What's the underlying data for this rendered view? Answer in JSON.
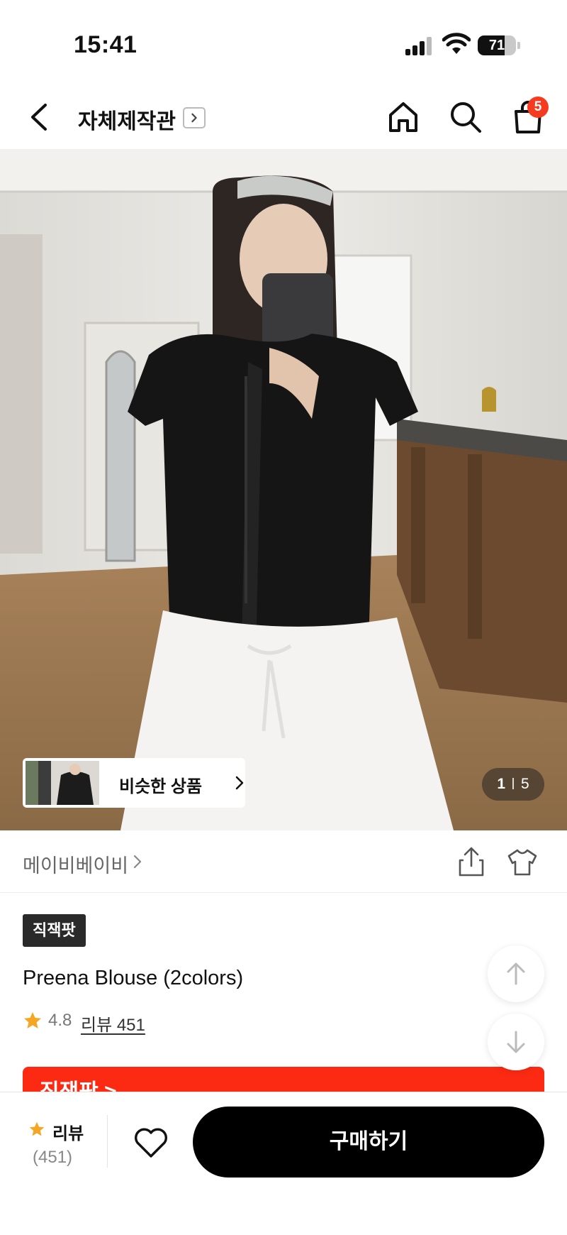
{
  "status_bar": {
    "time": "15:41",
    "battery": "71",
    "battery_level": 0.71
  },
  "header": {
    "title": "자체제작관",
    "back_icon": "chevron-left-icon",
    "home_icon": "home-icon",
    "search_icon": "search-icon",
    "cart_icon": "shopping-bag-icon",
    "cart_count": "5"
  },
  "gallery": {
    "similar_label": "비슷한 상품",
    "current": "1",
    "total": "5"
  },
  "brand": {
    "name": "메이비베이비",
    "share_icon": "share-icon",
    "fit_icon": "tshirt-fit-icon"
  },
  "product": {
    "badge": "직잭팟",
    "name": "Preena Blouse (2colors)",
    "rating": "4.8",
    "review_link": "리뷰 451",
    "promo_text": "직잭팟 >"
  },
  "bottom_bar": {
    "review_label": "리뷰",
    "review_count": "(451)",
    "like_icon": "heart-icon",
    "buy_label": "구매하기"
  },
  "colors": {
    "accent": "#fc2a13",
    "badge": "#f53a1f",
    "star": "#f5a623",
    "button": "#000000"
  }
}
